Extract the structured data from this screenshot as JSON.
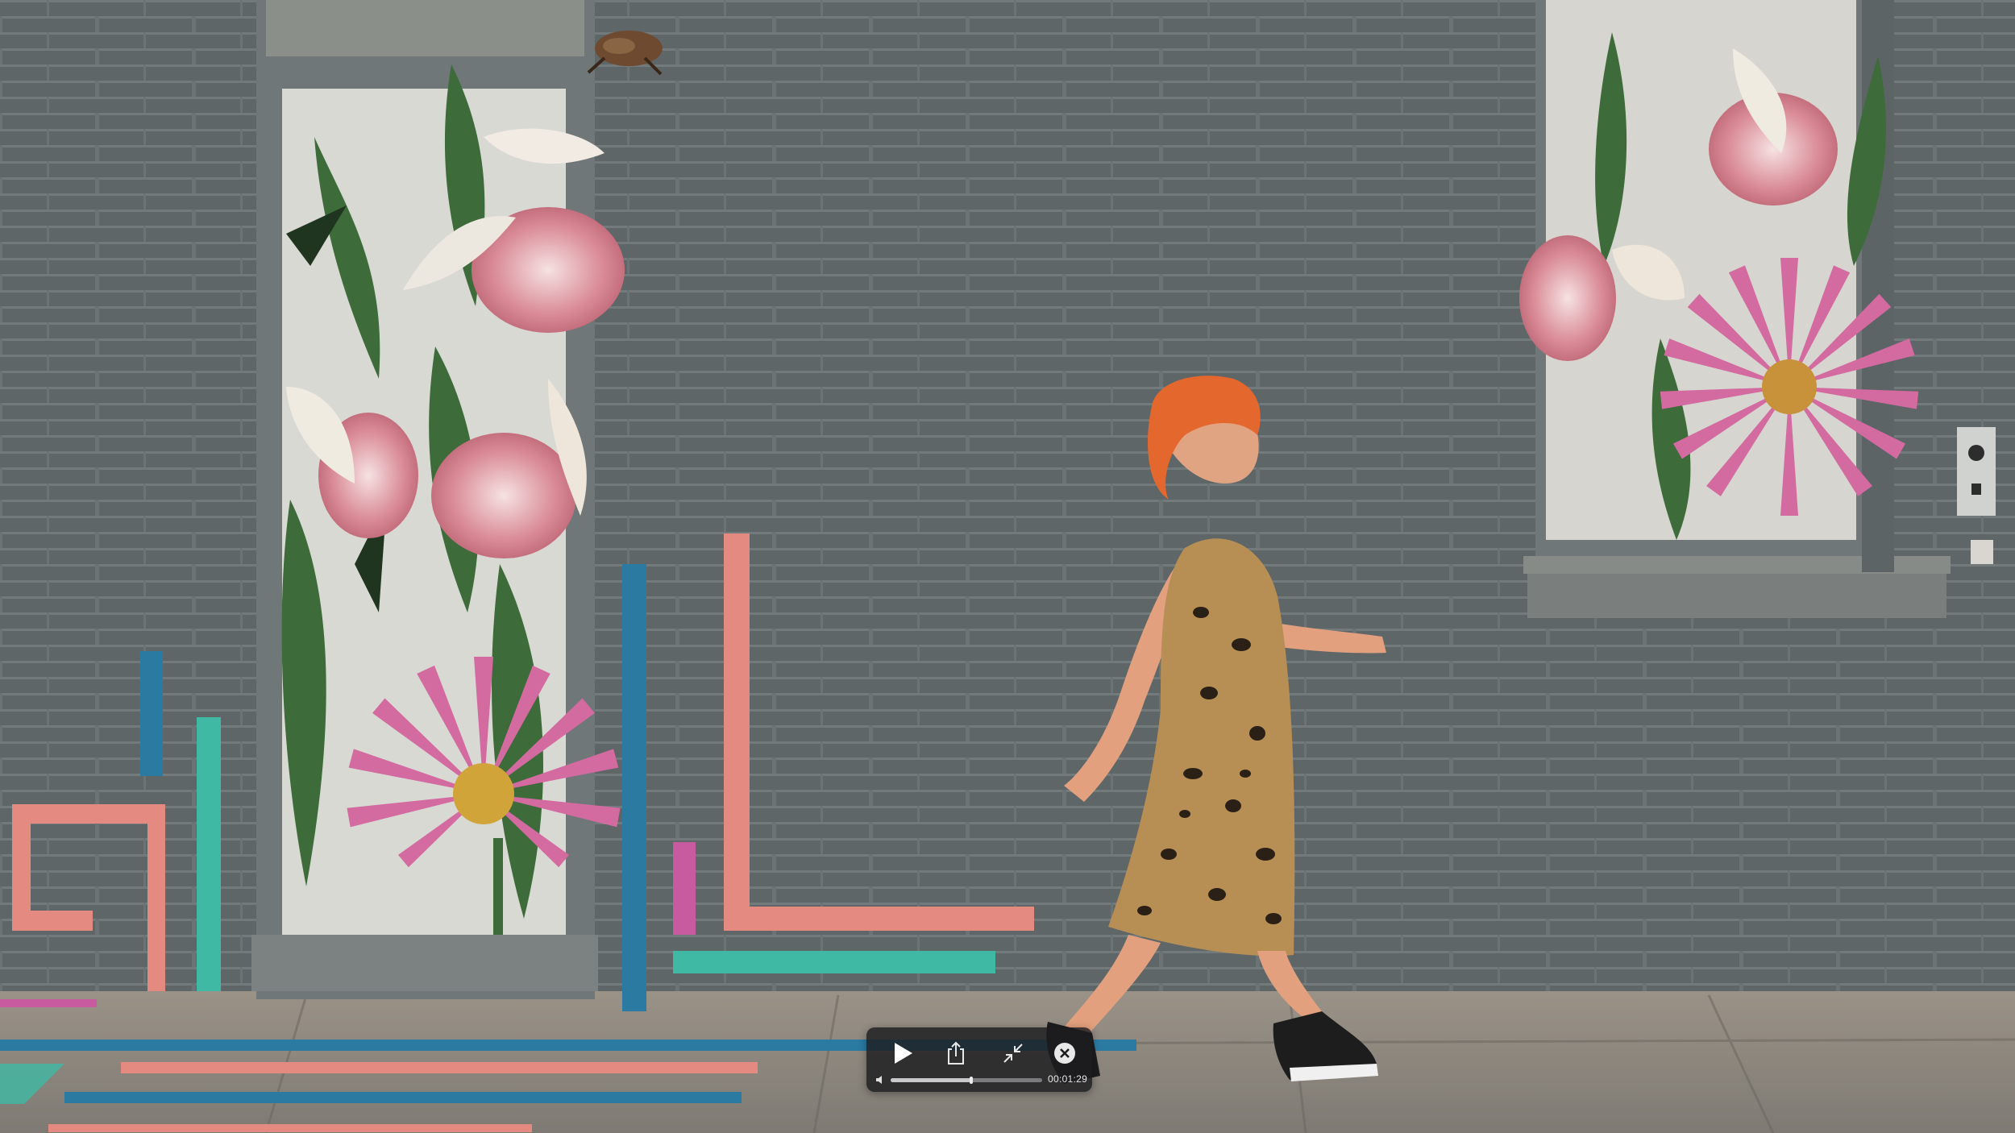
{
  "player": {
    "time": "00:01:29",
    "progress": 0.53
  },
  "icons": {
    "play": "play-icon",
    "share": "share-icon",
    "exit_fullscreen": "exit-fullscreen-icon",
    "close": "close-icon",
    "volume": "volume-icon"
  },
  "colors": {
    "wall": "#60686a",
    "mortar": "#73797a",
    "sidewalk": "#8a8478",
    "coral": "#e58a80",
    "teal": "#3fb9a4",
    "blue": "#2a7aa2",
    "hud_bg": "#1c1c1e"
  }
}
